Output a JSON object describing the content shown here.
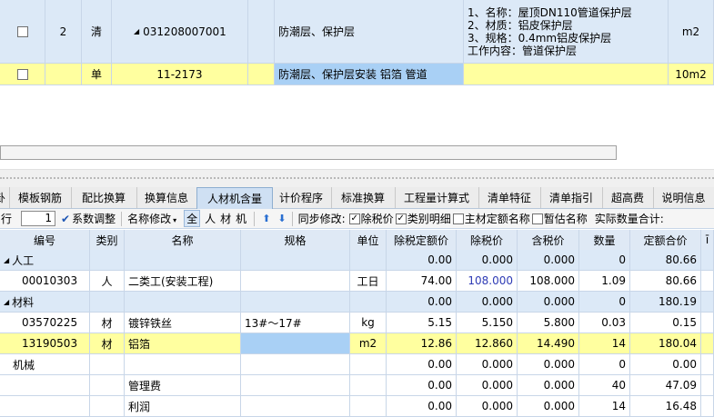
{
  "top_grid": {
    "row1": {
      "seq": "2",
      "type": "清",
      "code": "031208007001",
      "name": "防潮层、保护层",
      "feature_lines": [
        "1、名称：屋顶DN110管道保护层",
        "2、材质：铝皮保护层",
        "3、规格：0.4mm铝皮保护层",
        "工作内容：管道保护层"
      ],
      "unit": "m2"
    },
    "row2": {
      "type": "单",
      "code": "11-2173",
      "name": "防潮层、保护层安装 铝箔 管道",
      "unit": "10m2"
    }
  },
  "tabs": [
    "模板钢筋",
    "配比换算",
    "换算信息",
    "人材机含量",
    "计价程序",
    "标准换算",
    "工程量计算式",
    "清单特征",
    "清单指引",
    "超高费",
    "说明信息"
  ],
  "active_tab": "人材机含量",
  "toolbar": {
    "row_label": "行",
    "spin_value": "1",
    "coef_adjust": "系数调整",
    "name_modify": "名称修改",
    "filters": [
      "全",
      "人",
      "材",
      "机"
    ],
    "sync_modify": "同步修改:",
    "chk_tax": "除税价",
    "chk_class": "类别明细",
    "chk_main": "主材定额名称",
    "chk_temp": "暂估名称",
    "actual_qty": "实际数量合计:"
  },
  "columns": [
    "编号",
    "类别",
    "名称",
    "规格",
    "单位",
    "除税定额价",
    "除税价",
    "含税价",
    "数量",
    "定额合价"
  ],
  "rows": [
    {
      "kind": "group",
      "code": "人工",
      "c6": "0.00",
      "c7": "0.000",
      "c8": "0.000",
      "c9": "0",
      "c10": "80.66"
    },
    {
      "kind": "item",
      "code": "00010303",
      "cat": "人",
      "name": "二类工(安装工程)",
      "spec": "",
      "unit": "工日",
      "c6": "74.00",
      "c7": "108.000",
      "c8": "108.000",
      "c9": "1.09",
      "c10": "80.66"
    },
    {
      "kind": "group",
      "code": "材料",
      "c6": "0.00",
      "c7": "0.000",
      "c8": "0.000",
      "c9": "0",
      "c10": "180.19"
    },
    {
      "kind": "item",
      "code": "03570225",
      "cat": "材",
      "name": "镀锌铁丝",
      "spec": "13#～17#",
      "unit": "kg",
      "c6": "5.15",
      "c7": "5.150",
      "c8": "5.800",
      "c9": "0.03",
      "c10": "0.15"
    },
    {
      "kind": "item",
      "code": "13190503",
      "cat": "材",
      "name": "铝箔",
      "spec": "",
      "unit": "m2",
      "c6": "12.86",
      "c7": "12.860",
      "c8": "14.490",
      "c9": "14",
      "c10": "180.04"
    },
    {
      "kind": "plain",
      "code": "机械",
      "c6": "0.00",
      "c7": "0.000",
      "c8": "0.000",
      "c9": "0",
      "c10": "0.00"
    },
    {
      "kind": "item",
      "code": "",
      "cat": "",
      "name": "管理费",
      "spec": "",
      "unit": "",
      "c6": "0.00",
      "c7": "0.000",
      "c8": "0.000",
      "c9": "40",
      "c10": "47.09"
    },
    {
      "kind": "item",
      "code": "",
      "cat": "",
      "name": "利润",
      "spec": "",
      "unit": "",
      "c6": "0.00",
      "c7": "0.000",
      "c8": "0.000",
      "c9": "14",
      "c10": "16.48"
    }
  ],
  "colors": {
    "blue_row": "#dce9f7",
    "yellow_row": "#ffff9f",
    "selected": "#a9d0f5",
    "price_blue": "#2e3bb5"
  }
}
